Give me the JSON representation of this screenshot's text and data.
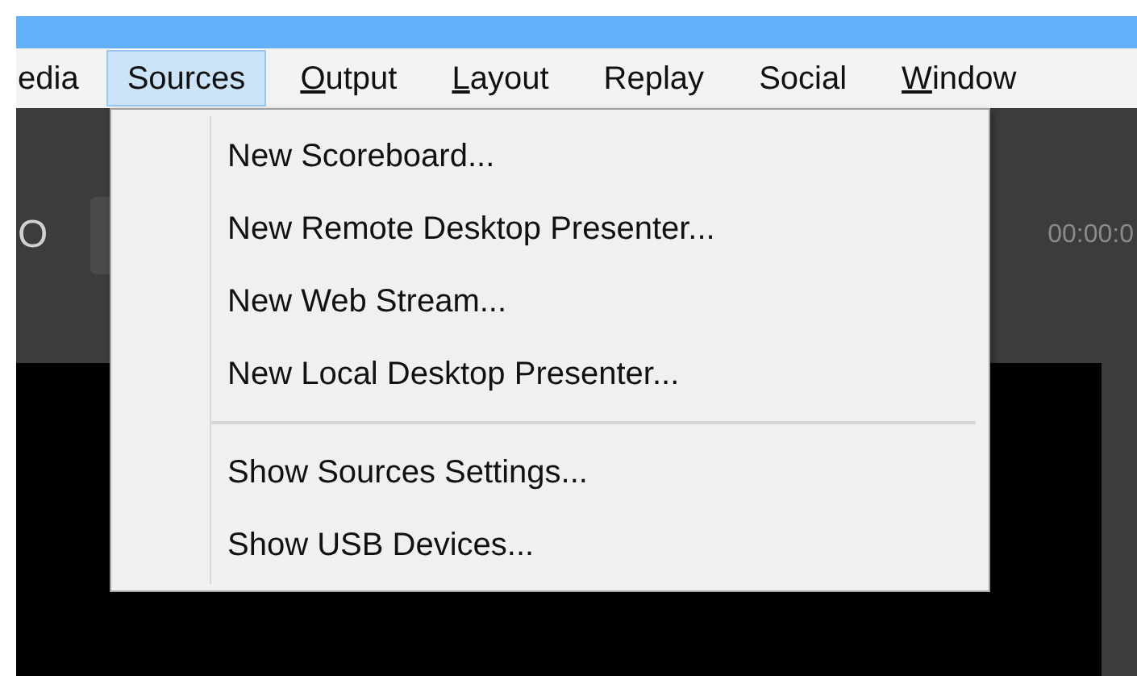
{
  "menubar": [
    {
      "label": "edia",
      "underlined_first_letter": false,
      "selected": false
    },
    {
      "label": "Sources",
      "underlined_first_letter": false,
      "selected": true
    },
    {
      "label": "Output",
      "underlined_first_letter": true,
      "selected": false
    },
    {
      "label": "Layout",
      "underlined_first_letter": true,
      "selected": false
    },
    {
      "label": "Replay",
      "underlined_first_letter": false,
      "selected": false
    },
    {
      "label": "Social",
      "underlined_first_letter": false,
      "selected": false
    },
    {
      "label": "Window",
      "underlined_first_letter": true,
      "selected": false
    }
  ],
  "toolbar_label": "O",
  "timecode": "00:00:0",
  "menu": [
    {
      "kind": "item",
      "label": "New Scoreboard..."
    },
    {
      "kind": "item",
      "label": "New Remote Desktop Presenter..."
    },
    {
      "kind": "item",
      "label": "New Web Stream..."
    },
    {
      "kind": "item",
      "label": "New Local Desktop Presenter..."
    },
    {
      "kind": "separator"
    },
    {
      "kind": "item",
      "label": "Show Sources Settings..."
    },
    {
      "kind": "item",
      "label": "Show USB Devices..."
    }
  ]
}
